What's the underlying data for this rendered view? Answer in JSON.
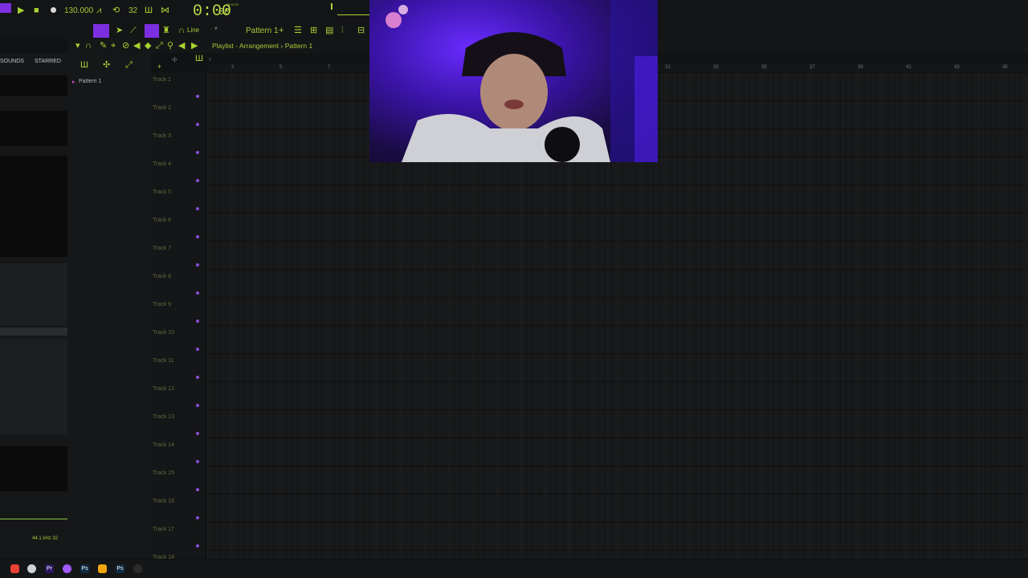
{
  "transport": {
    "tempo": "130.000",
    "time_sig_value": "32",
    "time_display": "0:00",
    "time_small": "00",
    "time_unit": "M:S:CS"
  },
  "toolbar2": {
    "snap_label": "Line",
    "pattern_selector": "Pattern 1"
  },
  "browser": {
    "tab_sounds": "SOUNDS",
    "tab_starred": "STARRED",
    "sample_rate": "44.1 kHz 32"
  },
  "playlist": {
    "title": "Playlist - Arrangement › Pattern 1",
    "pattern_item": "Pattern 1",
    "tracks": [
      "Track 1",
      "Track 2",
      "Track 3",
      "Track 4",
      "Track 5",
      "Track 6",
      "Track 7",
      "Track 8",
      "Track 9",
      "Track 10",
      "Track 11",
      "Track 12",
      "Track 13",
      "Track 14",
      "Track 15",
      "Track 16",
      "Track 17",
      "Track 18"
    ],
    "ruler_numbers": [
      "3",
      "5",
      "7",
      "19",
      "21",
      "23",
      "25",
      "27",
      "29",
      "31",
      "33",
      "35",
      "37",
      "39",
      "41",
      "43",
      "45"
    ]
  },
  "taskbar": {
    "icons": [
      "chrome-icon",
      "settings-icon",
      "premiere-icon",
      "messenger-icon",
      "photoshop-icon",
      "fl-studio-icon",
      "photoshop-icon",
      "app-icon"
    ]
  },
  "colors": {
    "accent_green": "#a9d233",
    "accent_purple": "#8a2be2",
    "background": "#111213"
  }
}
